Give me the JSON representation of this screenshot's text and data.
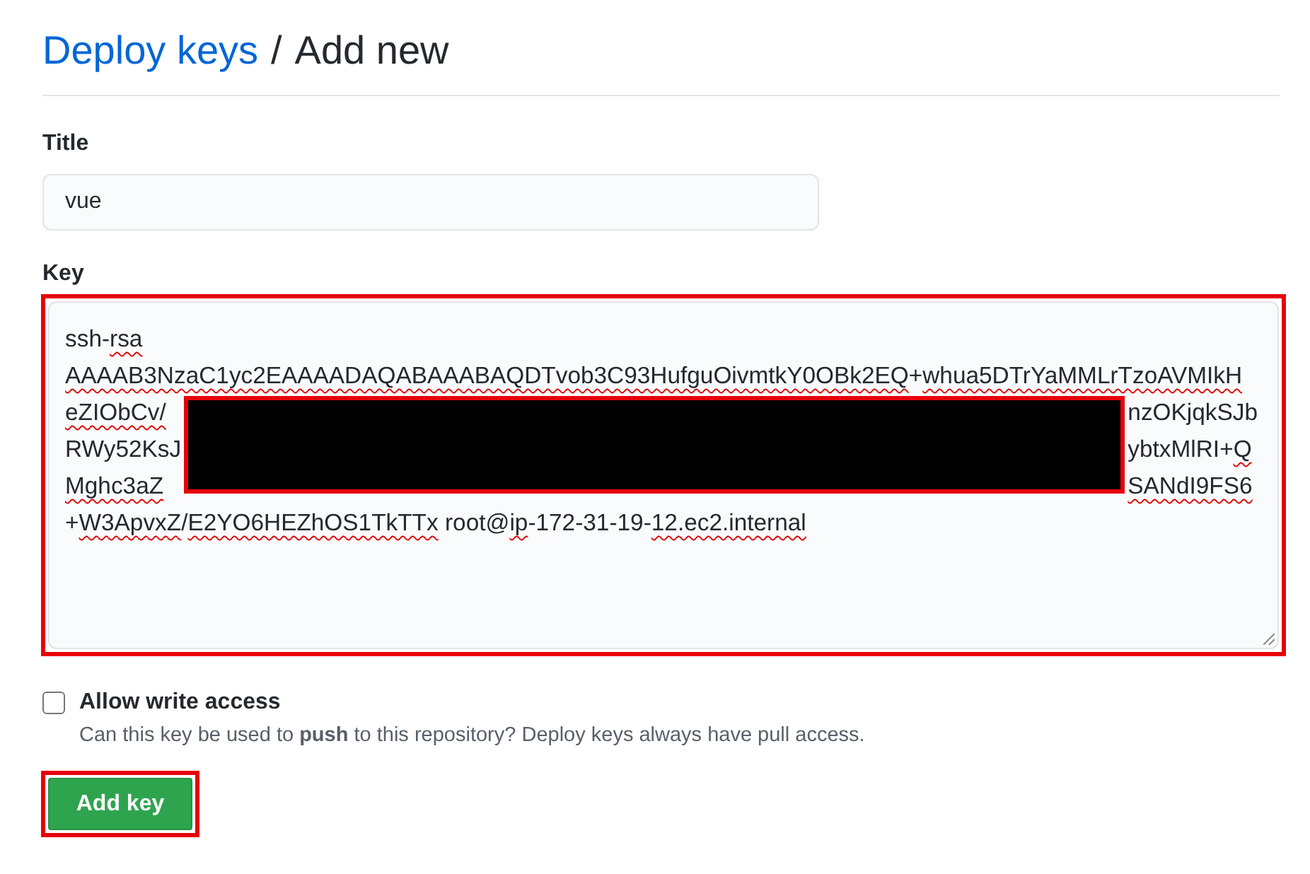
{
  "breadcrumb": {
    "link": "Deploy keys",
    "separator": "/",
    "current": "Add new"
  },
  "title_field": {
    "label": "Title",
    "value": "vue"
  },
  "key_field": {
    "label": "Key",
    "highlighted": true,
    "blocks": [
      {
        "kind": "text",
        "lines": [
          [
            {
              "text": "ssh-",
              "misspelled": false
            },
            {
              "text": "rsa",
              "misspelled": true
            }
          ],
          [
            {
              "text": "AAAAB3NzaC1yc2EAAAADAQABAAABAQDTvob3C93HufguOivmtkY0OBk2EQ",
              "misspelled": true
            },
            {
              "text": "+",
              "misspelled": false
            },
            {
              "text": "whua5DTrYaMMLrTzoAVMIkH",
              "misspelled": true
            }
          ]
        ]
      },
      {
        "kind": "redacted",
        "rows": [
          {
            "left": [
              {
                "text": "eZIObCv/",
                "misspelled": true
              }
            ],
            "right": [
              {
                "text": "nzOKjqkSJb",
                "misspelled": false
              }
            ]
          },
          {
            "left": [
              {
                "text": "RWy52KsJ",
                "misspelled": false
              }
            ],
            "right": [
              {
                "text": "ybtxMlRI+",
                "misspelled": false
              },
              {
                "text": "Q",
                "misspelled": true
              }
            ]
          },
          {
            "left": [
              {
                "text": "Mghc3aZ",
                "misspelled": true
              }
            ],
            "right": [
              {
                "text": "SANdI9FS6",
                "misspelled": true
              }
            ]
          }
        ]
      },
      {
        "kind": "text",
        "lines": [
          [
            {
              "text": "+",
              "misspelled": false
            },
            {
              "text": "W3ApvxZ",
              "misspelled": true
            },
            {
              "text": "/",
              "misspelled": false
            },
            {
              "text": "E2YO6HEZhOS1TkTTx",
              "misspelled": true
            },
            {
              "text": " root@",
              "misspelled": false
            },
            {
              "text": "ip",
              "misspelled": true
            },
            {
              "text": "-172-31-19-",
              "misspelled": false
            },
            {
              "text": "12.ec2.internal",
              "misspelled": true
            }
          ]
        ]
      }
    ]
  },
  "write_access": {
    "label": "Allow write access",
    "checked": false,
    "note": "Can this key be used to **push** to this repository? Deploy keys always have pull access."
  },
  "submit": {
    "label": "Add key",
    "highlighted": true
  }
}
